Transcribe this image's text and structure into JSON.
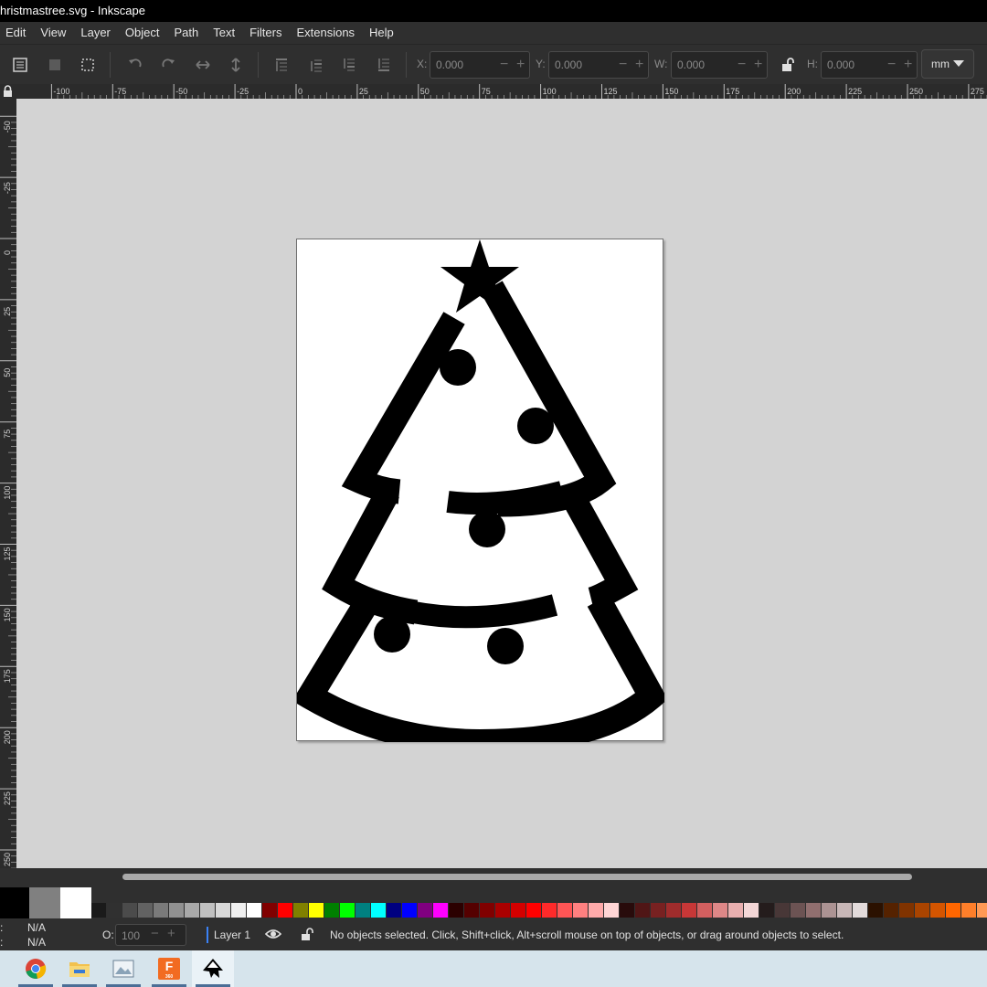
{
  "window": {
    "title": "hristmastree.svg - Inkscape"
  },
  "menu": [
    "Edit",
    "View",
    "Layer",
    "Object",
    "Path",
    "Text",
    "Filters",
    "Extensions",
    "Help"
  ],
  "toolbar": {
    "x_label": "X:",
    "x_value": "0.000",
    "y_label": "Y:",
    "y_value": "0.000",
    "w_label": "W:",
    "w_value": "0.000",
    "h_label": "H:",
    "h_value": "0.000",
    "unit": "mm"
  },
  "ruler": {
    "h_ticks": [
      "-100",
      "-75",
      "-50",
      "-25",
      "0",
      "25",
      "50",
      "75",
      "100",
      "125",
      "150",
      "175",
      "200",
      "225",
      "250",
      "275"
    ],
    "v_ticks": [
      "-50",
      "-25",
      "0",
      "25",
      "50",
      "75",
      "100",
      "125",
      "150",
      "175",
      "200",
      "225",
      "250"
    ]
  },
  "palette": {
    "colors": [
      "#303030",
      "#4b4b4b",
      "#626262",
      "#7a7a7a",
      "#919191",
      "#a9a9a9",
      "#c0c0c0",
      "#d8d8d8",
      "#efefef",
      "#ffffff",
      "#800000",
      "#ff0000",
      "#808000",
      "#ffff00",
      "#008000",
      "#00ff00",
      "#008080",
      "#00ffff",
      "#000080",
      "#0000ff",
      "#800080",
      "#ff00ff",
      "#2b0000",
      "#550000",
      "#800000",
      "#aa0000",
      "#d40000",
      "#ff0000",
      "#ff2a2a",
      "#ff5555",
      "#ff8080",
      "#ffaaaa",
      "#ffd5d5",
      "#280b0b",
      "#501616",
      "#782121",
      "#a02c2c",
      "#c83737",
      "#d35f5f",
      "#de8787",
      "#e9afaf",
      "#f4d7d7",
      "#241c1c",
      "#483737",
      "#6c5353",
      "#916f6f",
      "#ac9393",
      "#c8b7b7",
      "#e3dbdb",
      "#2b1100",
      "#552200",
      "#803300",
      "#aa4400",
      "#d45500",
      "#ff6600",
      "#ff7f2a",
      "#ff9955"
    ]
  },
  "status": {
    "fill_label": "N/A",
    "stroke_label": "N/A",
    "opacity_label": "O:",
    "opacity_value": "100",
    "layer": "Layer 1",
    "message": "No objects selected. Click, Shift+click, Alt+scroll mouse on top of objects, or drag around objects to select."
  },
  "taskbar": {
    "apps": [
      "chrome-icon",
      "file-explorer-icon",
      "photos-icon",
      "fusion-360-icon",
      "inkscape-icon"
    ],
    "fusion_badge": "F",
    "fusion_sub": "360"
  }
}
